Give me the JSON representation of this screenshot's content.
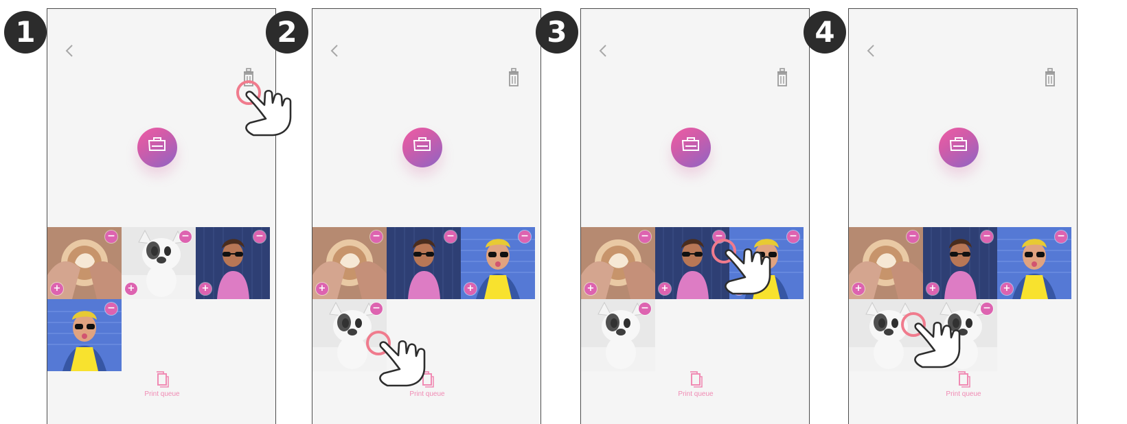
{
  "steps": [
    {
      "badge": "1",
      "print_queue_label": "Print queue",
      "icons": {
        "back": "chevron-left-icon",
        "trash": "trash-icon",
        "hero": "print-icon",
        "queue": "print-queue-icon",
        "touch": "tap-hand-icon"
      },
      "tiles": [
        "coffee",
        "dog",
        "man",
        "woman"
      ]
    },
    {
      "badge": "2",
      "print_queue_label": "Print queue",
      "icons": {
        "back": "chevron-left-icon",
        "trash": "trash-icon",
        "hero": "print-icon",
        "queue": "print-queue-icon",
        "touch": "tap-hand-icon"
      },
      "tiles": [
        "coffee",
        "man",
        "woman",
        "dog"
      ]
    },
    {
      "badge": "3",
      "print_queue_label": "Print queue",
      "icons": {
        "back": "chevron-left-icon",
        "trash": "trash-icon",
        "hero": "print-icon",
        "queue": "print-queue-icon",
        "touch": "tap-hand-icon"
      },
      "tiles": [
        "coffee",
        "man",
        "woman",
        "dog"
      ]
    },
    {
      "badge": "4",
      "print_queue_label": "Print queue",
      "icons": {
        "back": "chevron-left-icon",
        "trash": "trash-icon",
        "hero": "print-icon",
        "queue": "print-queue-icon",
        "touch": "tap-hand-icon"
      },
      "tiles": [
        "coffee",
        "man",
        "woman",
        "dog",
        "dog"
      ]
    }
  ],
  "colors": {
    "accent": "#dd63b0",
    "accent_light": "#f08ab3",
    "frame": "#4b4b4b",
    "screen": "#f5f5f5",
    "badge": "#2c2c2c",
    "touch_ring": "#f07b8d"
  }
}
